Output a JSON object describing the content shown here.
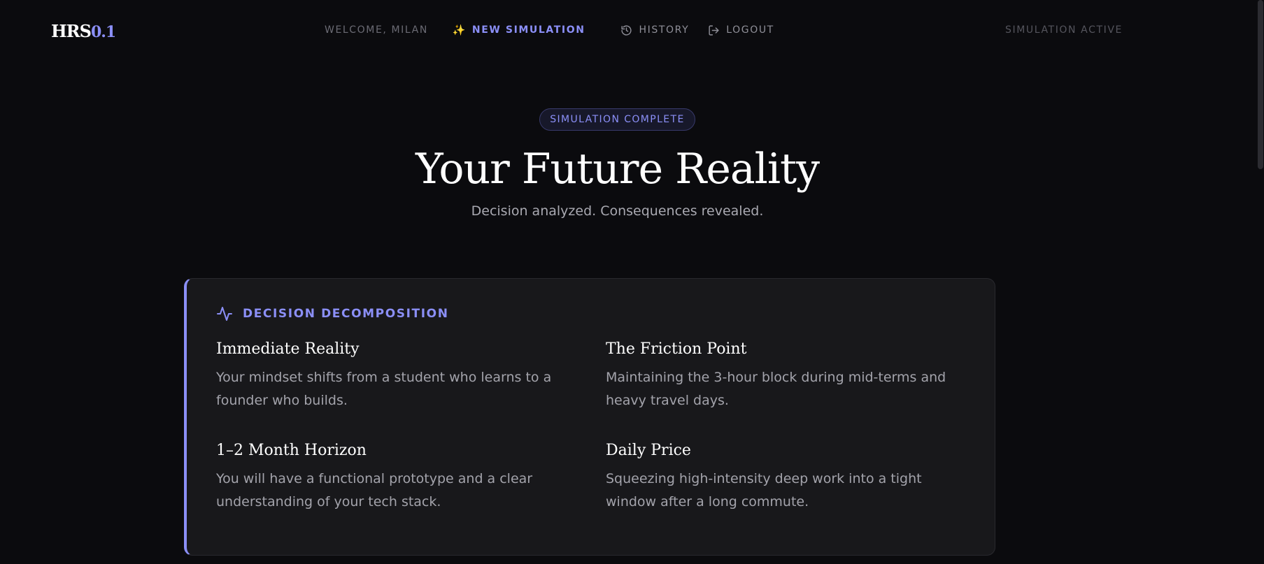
{
  "header": {
    "logo_main": "HRS",
    "logo_version": "0.1",
    "welcome": "WELCOME, MILAN",
    "nav": {
      "new_simulation": "NEW SIMULATION",
      "history": "HISTORY",
      "logout": "LOGOUT"
    },
    "status": "SIMULATION ACTIVE"
  },
  "hero": {
    "badge": "SIMULATION COMPLETE",
    "title": "Your Future Reality",
    "subtitle": "Decision analyzed. Consequences revealed."
  },
  "card": {
    "heading": "DECISION DECOMPOSITION",
    "accent_color": "#8b8ff7",
    "items": [
      {
        "title": "Immediate Reality",
        "body": "Your mindset shifts from a student who learns to a founder who builds."
      },
      {
        "title": "The Friction Point",
        "body": "Maintaining the 3-hour block during mid-terms and heavy travel days."
      },
      {
        "title": "1–2 Month Horizon",
        "body": "You will have a functional prototype and a clear understanding of your tech stack."
      },
      {
        "title": "Daily Price",
        "body": "Squeezing high-intensity deep work into a tight window after a long commute."
      }
    ]
  },
  "icons": {
    "new_simulation": "sparkle-icon",
    "history": "history-icon",
    "logout": "logout-icon",
    "card_heading": "pulse-icon"
  }
}
